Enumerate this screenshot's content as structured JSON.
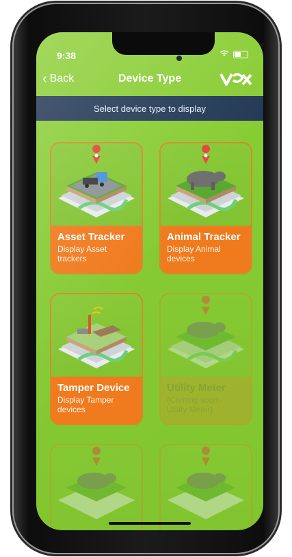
{
  "status": {
    "time": "9:38"
  },
  "nav": {
    "back_label": "Back",
    "title": "Device Type",
    "logo_text": "VOX"
  },
  "subtitle": "Select device type to display",
  "cards": [
    {
      "name": "Asset Tracker",
      "desc": "Display Asset trackers",
      "enabled": true
    },
    {
      "name": "Animal Tracker",
      "desc": "Display Animal devices",
      "enabled": true
    },
    {
      "name": "Tamper Device",
      "desc": "Display Tamper devices",
      "enabled": true
    },
    {
      "name": "Utility Meter",
      "desc": "(Coming soon - Utility Meter)",
      "enabled": false
    },
    {
      "name": "",
      "desc": "",
      "enabled": false
    },
    {
      "name": "",
      "desc": "",
      "enabled": false
    }
  ],
  "colors": {
    "background_green": "#86cb33",
    "card_orange": "#f07a1e",
    "header_navy": "#243a56"
  }
}
